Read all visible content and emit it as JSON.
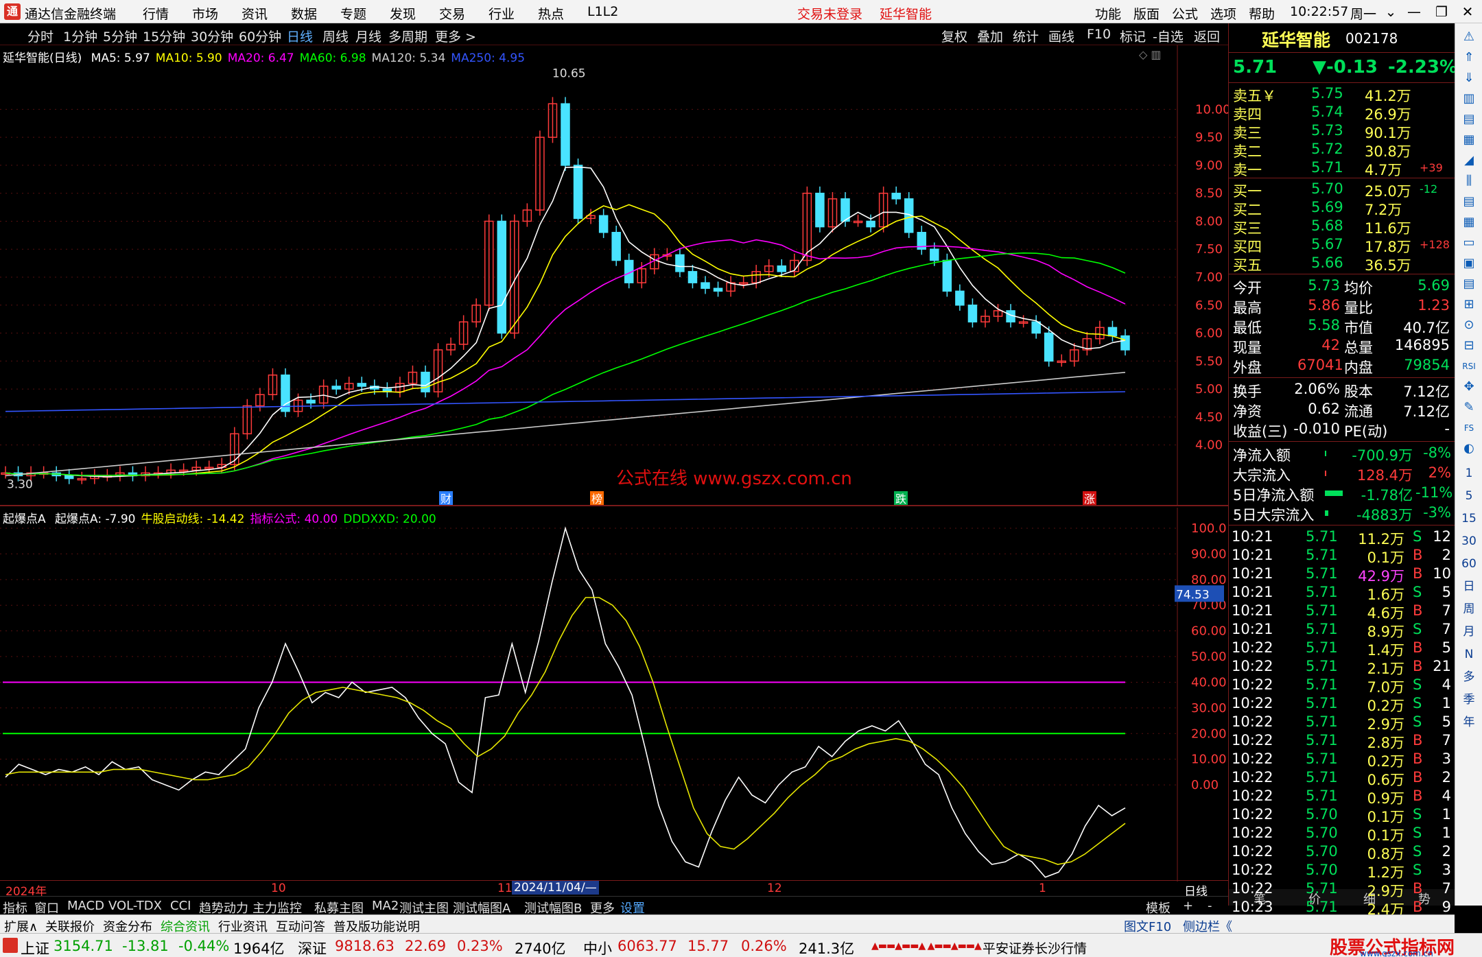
{
  "menubar": {
    "app_title": "通达信金融终端",
    "menus": [
      "行情",
      "市场",
      "资讯",
      "数据",
      "专题",
      "发现",
      "交易",
      "行业",
      "热点",
      "L1L2"
    ],
    "trade_status": "交易未登录",
    "stock_name": "延华智能",
    "right_menus": [
      "功能",
      "版面",
      "公式",
      "选项",
      "帮助"
    ],
    "time": "10:22:57",
    "weekday": "周一"
  },
  "toolbar": {
    "periods": [
      "分时",
      "1分钟",
      "5分钟",
      "15分钟",
      "30分钟",
      "60分钟",
      "日线",
      "周线",
      "月线",
      "多周期",
      "更多 >"
    ],
    "active_period": "日线",
    "actions": [
      "复权",
      "叠加",
      "统计",
      "画线",
      "F10",
      "标记",
      "-自选",
      "返回"
    ]
  },
  "main_chart": {
    "title": "延华智能(日线)",
    "ma_values": [
      {
        "label": "MA5: 5.97",
        "color": "#ffffff"
      },
      {
        "label": "MA10: 5.90",
        "color": "#ffff00"
      },
      {
        "label": "MA20: 6.47",
        "color": "#ff00ff"
      },
      {
        "label": "MA60: 6.98",
        "color": "#00ff00"
      },
      {
        "label": "MA120: 5.34",
        "color": "#cccccc"
      },
      {
        "label": "MA250: 4.95",
        "color": "#3355ff"
      }
    ],
    "high_label": "10.65",
    "low_label": "3.30",
    "price_axis": [
      "10.00",
      "9.50",
      "9.00",
      "8.50",
      "8.00",
      "7.50",
      "7.00",
      "6.50",
      "6.00",
      "5.50",
      "5.00",
      "4.50",
      "4.00"
    ],
    "watermark": "公式在线  www.gszx.com.cn",
    "event_markers": [
      {
        "text": "财",
        "color": "#2a7fff"
      },
      {
        "text": "榜",
        "color": "#ff6a00"
      },
      {
        "text": "跌",
        "color": "#00b050"
      },
      {
        "text": "涨",
        "color": "#d01010"
      }
    ]
  },
  "indicator": {
    "title": "起爆点A",
    "values": [
      {
        "label": "起爆点A: -7.90",
        "color": "#ffffff"
      },
      {
        "label": "牛股启动线: -14.42",
        "color": "#ffff00"
      },
      {
        "label": "指标公式: 40.00",
        "color": "#ff00ff"
      },
      {
        "label": "DDDXXD: 20.00",
        "color": "#00ff00"
      }
    ],
    "axis": [
      "100.0",
      "90.00",
      "80.00",
      "70.00",
      "60.00",
      "50.00",
      "40.00",
      "30.00",
      "20.00",
      "10.00",
      "0.00"
    ],
    "cursor_value": "74.53"
  },
  "time_axis": {
    "labels": [
      "2024年",
      "10",
      "11",
      "2024/11/04/—",
      "12",
      "1"
    ],
    "right_label": "日线"
  },
  "chart_data": {
    "type": "line",
    "series": [
      {
        "name": "起爆点A",
        "values": [
          3,
          8,
          6,
          4,
          6,
          5,
          7,
          4,
          9,
          6,
          7,
          2,
          0,
          -2,
          2,
          5,
          4,
          9,
          14,
          30,
          40,
          55,
          44,
          32,
          36,
          34,
          40,
          36,
          37,
          38,
          34,
          26,
          20,
          16,
          1,
          -3,
          34,
          35,
          55,
          36,
          56,
          79,
          100,
          84,
          76,
          55,
          46,
          35,
          14,
          -8,
          -22,
          -30,
          -32,
          -18,
          -6,
          3,
          -4,
          -7,
          0,
          5,
          7,
          15,
          11,
          17,
          21,
          23,
          21,
          25,
          17,
          8,
          4,
          -9,
          -19,
          -26,
          -31,
          -30,
          -27,
          -30,
          -36,
          -34,
          -27,
          -16,
          -8,
          -12,
          -9
        ]
      },
      {
        "name": "牛股启动线",
        "values": [
          4,
          5,
          5,
          5,
          5,
          5,
          5,
          5,
          6,
          6,
          6,
          5,
          4,
          3,
          2,
          2,
          3,
          4,
          7,
          13,
          20,
          28,
          33,
          36,
          37,
          38,
          37,
          36,
          35,
          34,
          32,
          29,
          25,
          22,
          16,
          11,
          14,
          19,
          28,
          35,
          44,
          56,
          66,
          73,
          73,
          70,
          64,
          54,
          40,
          23,
          7,
          -9,
          -19,
          -24,
          -25,
          -21,
          -16,
          -11,
          -5,
          0,
          4,
          9,
          11,
          14,
          16,
          17,
          18,
          17,
          14,
          10,
          5,
          -1,
          -9,
          -17,
          -24,
          -27,
          -28,
          -29,
          -31,
          -30,
          -27,
          -23,
          -19,
          -15
        ]
      }
    ],
    "reference_lines": [
      40,
      20
    ],
    "ylim": [
      -35,
      100
    ]
  },
  "quote": {
    "name": "延华智能",
    "code": "002178",
    "price": "5.71",
    "change": "▼-0.13",
    "change_pct": "-2.23%",
    "asks": [
      {
        "label": "卖五￥",
        "price": "5.75",
        "vol": "41.2万",
        "delta": ""
      },
      {
        "label": "卖四",
        "price": "5.74",
        "vol": "26.9万",
        "delta": ""
      },
      {
        "label": "卖三",
        "price": "5.73",
        "vol": "90.1万",
        "delta": ""
      },
      {
        "label": "卖二",
        "price": "5.72",
        "vol": "30.8万",
        "delta": ""
      },
      {
        "label": "卖一",
        "price": "5.71",
        "vol": "4.7万",
        "delta": "+39"
      }
    ],
    "bids": [
      {
        "label": "买一",
        "price": "5.70",
        "vol": "25.0万",
        "delta": "-12"
      },
      {
        "label": "买二",
        "price": "5.69",
        "vol": "7.2万",
        "delta": ""
      },
      {
        "label": "买三",
        "price": "5.68",
        "vol": "11.6万",
        "delta": ""
      },
      {
        "label": "买四",
        "price": "5.67",
        "vol": "17.8万",
        "delta": "+128"
      },
      {
        "label": "买五",
        "price": "5.66",
        "vol": "36.5万",
        "delta": ""
      }
    ],
    "stats": [
      {
        "l1": "今开",
        "v1": "5.73",
        "c1": "#00e05a",
        "l2": "均价",
        "v2": "5.69",
        "c2": "#00e05a"
      },
      {
        "l1": "最高",
        "v1": "5.86",
        "c1": "#ff3b3b",
        "l2": "量比",
        "v2": "1.23",
        "c2": "#ff3b3b"
      },
      {
        "l1": "最低",
        "v1": "5.58",
        "c1": "#00e05a",
        "l2": "市值",
        "v2": "40.7亿",
        "c2": "#ffffff"
      },
      {
        "l1": "现量",
        "v1": "42",
        "c1": "#ff3b3b",
        "l2": "总量",
        "v2": "146895",
        "c2": "#ffffff"
      },
      {
        "l1": "外盘",
        "v1": "67041",
        "c1": "#ff3b3b",
        "l2": "内盘",
        "v2": "79854",
        "c2": "#00e05a"
      }
    ],
    "stats2": [
      {
        "l1": "换手",
        "v1": "2.06%",
        "l2": "股本",
        "v2": "7.12亿"
      },
      {
        "l1": "净资",
        "v1": "0.62",
        "l2": "流通",
        "v2": "7.12亿"
      },
      {
        "l1": "收益(三)",
        "v1": "-0.010",
        "l2": "PE(动)",
        "v2": "-"
      }
    ],
    "flows": [
      {
        "label": "净流入额",
        "val": "-700.9万",
        "pct": "-8%",
        "color": "#00e05a",
        "bar": 0
      },
      {
        "label": "大宗流入",
        "val": "128.4万",
        "pct": "2%",
        "color": "#ff3b3b",
        "bar": 0
      },
      {
        "label": "5日净流入额",
        "val": "-1.78亿",
        "pct": "-11%",
        "color": "#00e05a",
        "bar": 1
      },
      {
        "label": "5日大宗流入",
        "val": "-4883万",
        "pct": "-3%",
        "color": "#00e05a",
        "bar": 0.2
      }
    ],
    "ticks": [
      {
        "t": "10:21",
        "p": "5.71",
        "v": "11.2万",
        "s": "S",
        "n": "12"
      },
      {
        "t": "10:21",
        "p": "5.71",
        "v": "0.1万",
        "s": "B",
        "n": "2"
      },
      {
        "t": "10:21",
        "p": "5.71",
        "v": "42.9万",
        "s": "B",
        "n": "10"
      },
      {
        "t": "10:21",
        "p": "5.71",
        "v": "1.6万",
        "s": "S",
        "n": "5"
      },
      {
        "t": "10:21",
        "p": "5.71",
        "v": "4.6万",
        "s": "B",
        "n": "7"
      },
      {
        "t": "10:21",
        "p": "5.71",
        "v": "8.9万",
        "s": "S",
        "n": "7"
      },
      {
        "t": "10:22",
        "p": "5.71",
        "v": "1.4万",
        "s": "B",
        "n": "5"
      },
      {
        "t": "10:22",
        "p": "5.71",
        "v": "2.1万",
        "s": "B",
        "n": "21"
      },
      {
        "t": "10:22",
        "p": "5.71",
        "v": "7.0万",
        "s": "S",
        "n": "4"
      },
      {
        "t": "10:22",
        "p": "5.71",
        "v": "0.2万",
        "s": "S",
        "n": "1"
      },
      {
        "t": "10:22",
        "p": "5.71",
        "v": "2.9万",
        "s": "S",
        "n": "5"
      },
      {
        "t": "10:22",
        "p": "5.71",
        "v": "2.8万",
        "s": "B",
        "n": "7"
      },
      {
        "t": "10:22",
        "p": "5.71",
        "v": "0.2万",
        "s": "B",
        "n": "3"
      },
      {
        "t": "10:22",
        "p": "5.71",
        "v": "0.6万",
        "s": "B",
        "n": "2"
      },
      {
        "t": "10:22",
        "p": "5.71",
        "v": "0.9万",
        "s": "B",
        "n": "4"
      },
      {
        "t": "10:22",
        "p": "5.70",
        "v": "0.1万",
        "s": "S",
        "n": "1"
      },
      {
        "t": "10:22",
        "p": "5.70",
        "v": "0.1万",
        "s": "S",
        "n": "1"
      },
      {
        "t": "10:22",
        "p": "5.70",
        "v": "0.8万",
        "s": "S",
        "n": "2"
      },
      {
        "t": "10:22",
        "p": "5.70",
        "v": "1.2万",
        "s": "S",
        "n": "3"
      },
      {
        "t": "10:22",
        "p": "5.71",
        "v": "2.9万",
        "s": "B",
        "n": "7"
      },
      {
        "t": "10:23",
        "p": "5.71",
        "v": "2.4万",
        "s": "B",
        "n": "9"
      }
    ]
  },
  "right_panel_tabs": [
    "笔",
    "价",
    "细",
    "势"
  ],
  "side_strip_labels": [
    "1",
    "5",
    "15",
    "30",
    "60",
    "日",
    "周",
    "月",
    "N",
    "多",
    "季",
    "年"
  ],
  "bottom_tabs": [
    "指标",
    "窗口",
    "MACD",
    "VOL-TDX",
    "CCI",
    "趋势动力",
    "主力监控",
    "私募主图",
    "MA2",
    "测试主图",
    "测试幅图A",
    "测试幅图B",
    "更多",
    "设置"
  ],
  "bottom_tabs_right": [
    "模板",
    "+",
    "-"
  ],
  "bottom_tabs2": [
    "扩展∧",
    "关联报价",
    "资金分布",
    "综合资讯",
    "行业资讯",
    "互动问答",
    "普及版功能说明"
  ],
  "bottom_tabs2_right": [
    "图文F10",
    "侧边栏《"
  ],
  "status": {
    "sh_label": "上证",
    "sh": "3154.71",
    "sh_chg": "-13.81",
    "sh_pct": "-0.44%",
    "sh_amt": "1964亿",
    "sz_label": "深证",
    "sz": "9818.63",
    "sz_chg": "22.69",
    "sz_pct": "0.23%",
    "sz_amt": "2740亿",
    "zx_label": "中小",
    "zx": "6063.77",
    "zx_chg": "15.77",
    "zx_pct": "0.26%",
    "zx_amt": "241.3亿",
    "broker": "平安证券长沙行情",
    "brand": "股票公式指标网",
    "brand_url": "www.gszx.com.cn"
  }
}
